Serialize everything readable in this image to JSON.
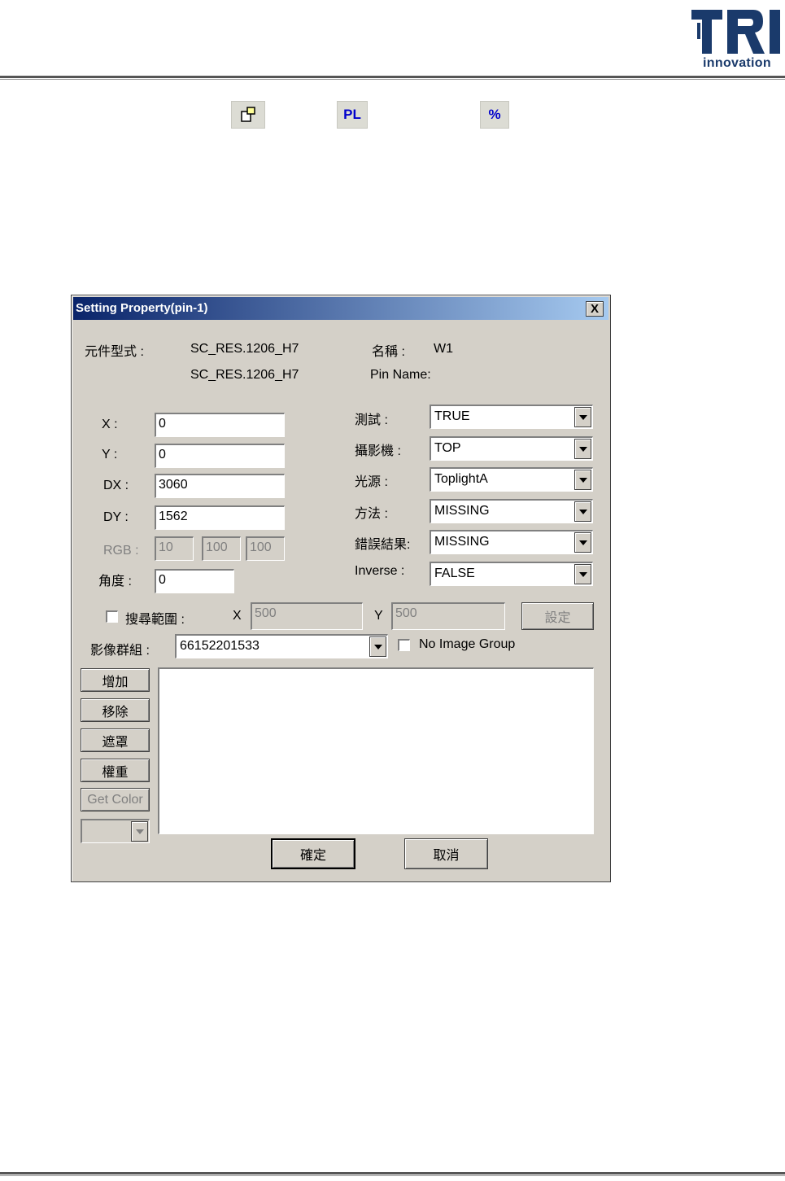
{
  "document": {
    "logo": {
      "letters": "TRI",
      "tagline": "innovation",
      "color": "#1a3a6b"
    },
    "toolbar_icons": [
      {
        "name": "property-icon"
      },
      {
        "name": "pl-icon",
        "text": "PL"
      },
      {
        "name": "percent-icon",
        "text": "%"
      }
    ]
  },
  "dialog": {
    "title": "Setting Property(pin-1)",
    "close_label": "X",
    "component_type_label": "元件型式 :",
    "component_type_value1": "SC_RES.1206_H7",
    "component_type_value2": "SC_RES.1206_H7",
    "name_label": "名稱 :",
    "name_value": "W1",
    "pin_name_label": "Pin Name:",
    "fields": {
      "x_label": "X :",
      "x_value": "0",
      "y_label": "Y :",
      "y_value": "0",
      "dx_label": "DX :",
      "dx_value": "3060",
      "dy_label": "DY :",
      "dy_value": "1562",
      "rgb_label": "RGB :",
      "rgb_values": [
        "10",
        "100",
        "100"
      ],
      "angle_label": "角度 :",
      "angle_value": "0"
    },
    "dropdowns": {
      "test_label": "測試 :",
      "test_value": "TRUE",
      "camera_label": "攝影機 :",
      "camera_value": "TOP",
      "light_label": "光源 :",
      "light_value": "ToplightA",
      "method_label": "方法 :",
      "method_value": "MISSING",
      "error_label": "錯誤結果:",
      "error_value": "MISSING",
      "inverse_label": "Inverse :",
      "inverse_value": "FALSE"
    },
    "search": {
      "label": "搜尋範圍 :",
      "x_label": "X",
      "x_value": "500",
      "y_label": "Y",
      "y_value": "500",
      "set_label": "設定"
    },
    "image_group": {
      "label": "影像群組 :",
      "value": "66152201533",
      "no_group_label": "No Image Group"
    },
    "side_buttons": {
      "add": "增加",
      "remove": "移除",
      "mask": "遮罩",
      "weight": "權重",
      "get_color": "Get Color"
    },
    "ok_label": "確定",
    "cancel_label": "取消"
  }
}
